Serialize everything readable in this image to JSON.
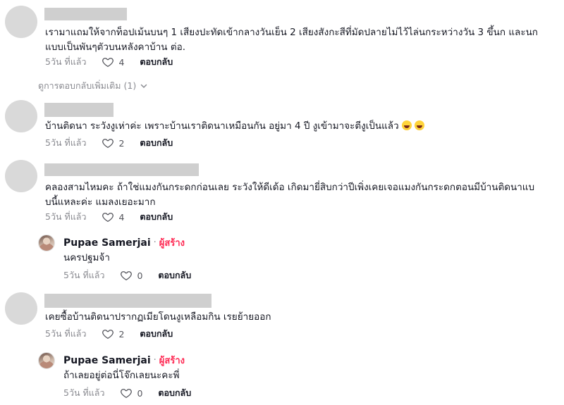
{
  "comments": [
    {
      "text_lines": [
        "เรามาแถมให้จากท็อปเม้นบนๆ 1 เสียงปะทัดเข้ากลางวันเย็น 2 เสียงสังกะสีที่มัดปลายไม่ไว้ไล่นกระหว่างวัน 3 ขึ้นก และนก",
        "แบบเป็นพันๆตัวบนหลังคาบ้าน ต่อ."
      ],
      "time": "5วัน ที่แล้ว",
      "likes": "4",
      "reply_label": "ตอบกลับ",
      "more_replies": "ดูการตอบกลับเพิ่มเติม (1)"
    },
    {
      "text_lines": [
        "บ้านติดนา ระวังงูเห่าค่ะ เพราะบ้านเราติดนาเหมือนกัน อยู่มา 4 ปี งูเข้ามาจะตีงูเป็นแล้ว"
      ],
      "time": "5วัน ที่แล้ว",
      "likes": "2",
      "reply_label": "ตอบกลับ"
    },
    {
      "text_lines": [
        "คลองสามไหมคะ ถ้าใช่แมงกันกระดกก่อนเลย ระวังให้ดีเด้อ เกิดมายี่สิบกว่าปีเพิ่งเคยเจอแมงกันกระดกตอนมีบ้านติดนาแบ",
        "บนี้แหละค่ะ แมลงเยอะมาก"
      ],
      "time": "5วัน ที่แล้ว",
      "likes": "4",
      "reply_label": "ตอบกลับ",
      "reply": {
        "author": "Pupae Samerjai",
        "separator": "·",
        "badge": "ผู้สร้าง",
        "text": "นครปฐมจ้า",
        "time": "5วัน ที่แล้ว",
        "likes": "0",
        "reply_label": "ตอบกลับ"
      }
    },
    {
      "text_lines": [
        "เคยซื้อบ้านติดนาปรากฏเมียโดนงูเหลือมกิน เรยย้ายออก"
      ],
      "time": "5วัน ที่แล้ว",
      "likes": "2",
      "reply_label": "ตอบกลับ",
      "reply": {
        "author": "Pupae Samerjai",
        "separator": "·",
        "badge": "ผู้สร้าง",
        "text": "ถ้าเลยอยู่ต่อนี่โจ๊กเลยนะคะพี่",
        "time": "5วัน ที่แล้ว",
        "likes": "0",
        "reply_label": "ตอบกลับ"
      }
    }
  ],
  "icons": {
    "like": "heart-outline-icon",
    "expand": "chevron-down-icon",
    "emoji": "grinning-sweat-emoji-icon"
  },
  "colors": {
    "creator_badge": "#fe2c55",
    "meta_gray": "#8a8b91",
    "redacted_bar": "#cfcfcf",
    "avatar_placeholder": "#d9d9d9"
  }
}
